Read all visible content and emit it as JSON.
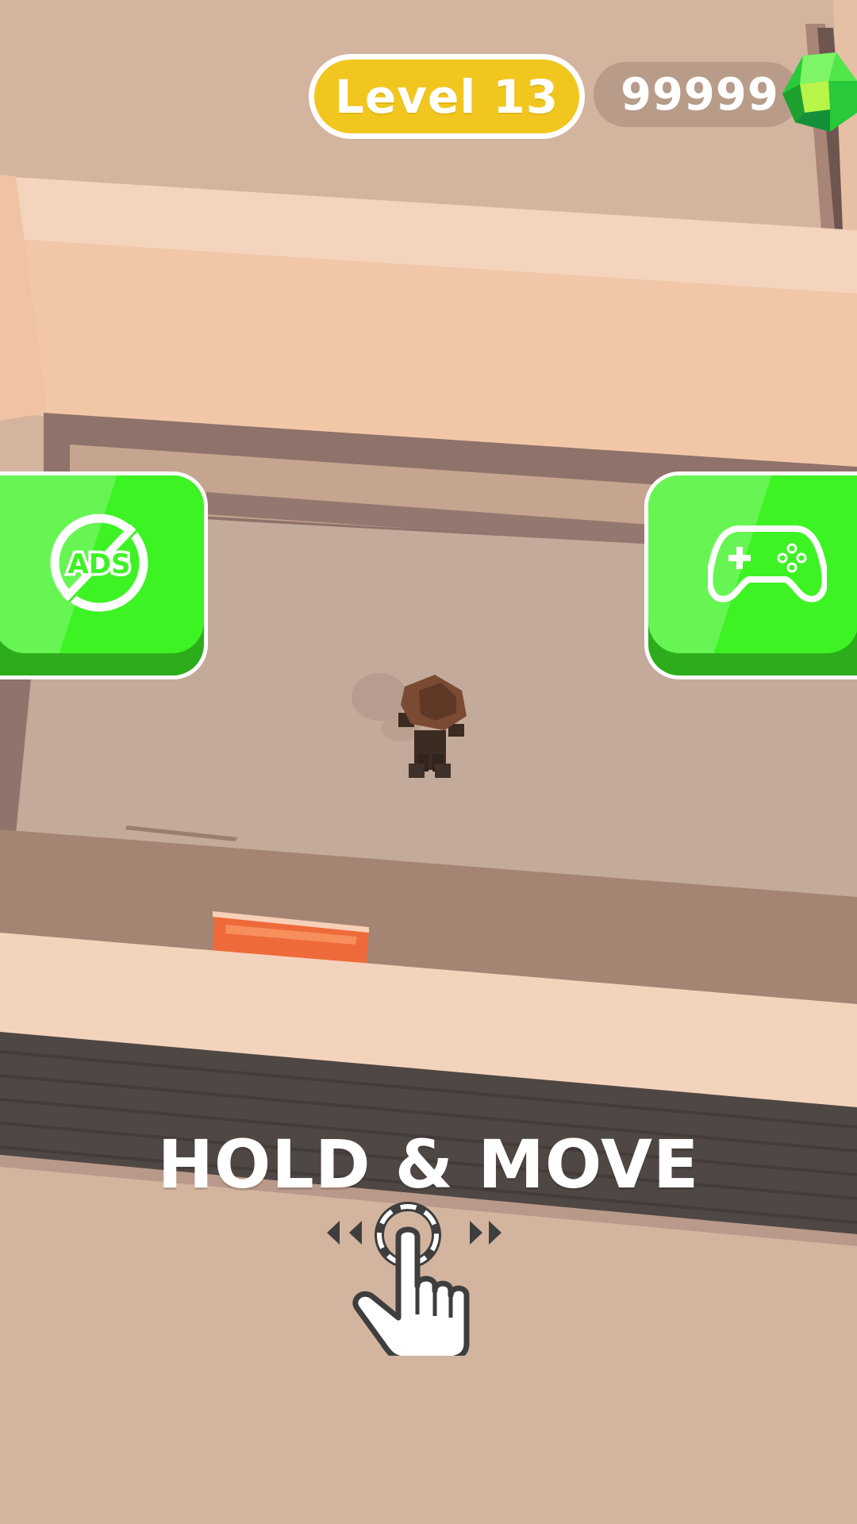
{
  "hud": {
    "level_label": "Level 13",
    "gems_count": "99999",
    "gem_icon": "green-gem-icon"
  },
  "buttons": {
    "no_ads": {
      "icon": "no-ads-icon",
      "icon_text": "ADS"
    },
    "games": {
      "icon": "gamepad-icon"
    }
  },
  "tutorial": {
    "hint_text": "HOLD & MOVE",
    "icon": "tap-hand-icon"
  },
  "colors": {
    "level_pill": "#f1c61e",
    "button_green": "#3df323",
    "button_green_dark": "#2dad1c"
  }
}
